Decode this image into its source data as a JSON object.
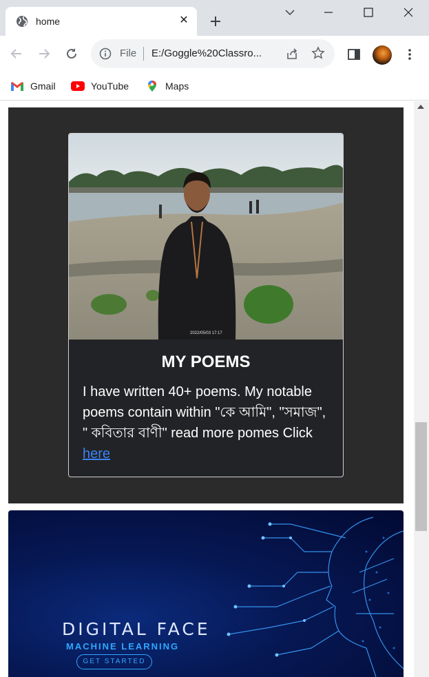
{
  "tab": {
    "title": "home",
    "favicon": "globe-icon"
  },
  "omnibox": {
    "scheme_label": "File",
    "url": "E:/Goggle%20Classro..."
  },
  "bookmarks": [
    {
      "label": "Gmail",
      "icon": "gmail-icon"
    },
    {
      "label": "YouTube",
      "icon": "youtube-icon"
    },
    {
      "label": "Maps",
      "icon": "maps-icon"
    }
  ],
  "card": {
    "title": "MY POEMS",
    "text_before_link": "I have written 40+ poems. My notable poems contain within \"কে আমি\", \"সমাজ\", \" কবিতার বাণী\" read more pomes Click ",
    "link_text": "here",
    "photo_timestamp": "2022/05/03 17:17"
  },
  "banner": {
    "title": "DIGITAL FACE",
    "subtitle": "MACHINE LEARNING",
    "button": "GET STARTED"
  },
  "colors": {
    "section_bg": "#2b2b2b",
    "card_bg": "#222326",
    "link": "#3b82f6",
    "banner_accent": "#2fa8ff"
  }
}
